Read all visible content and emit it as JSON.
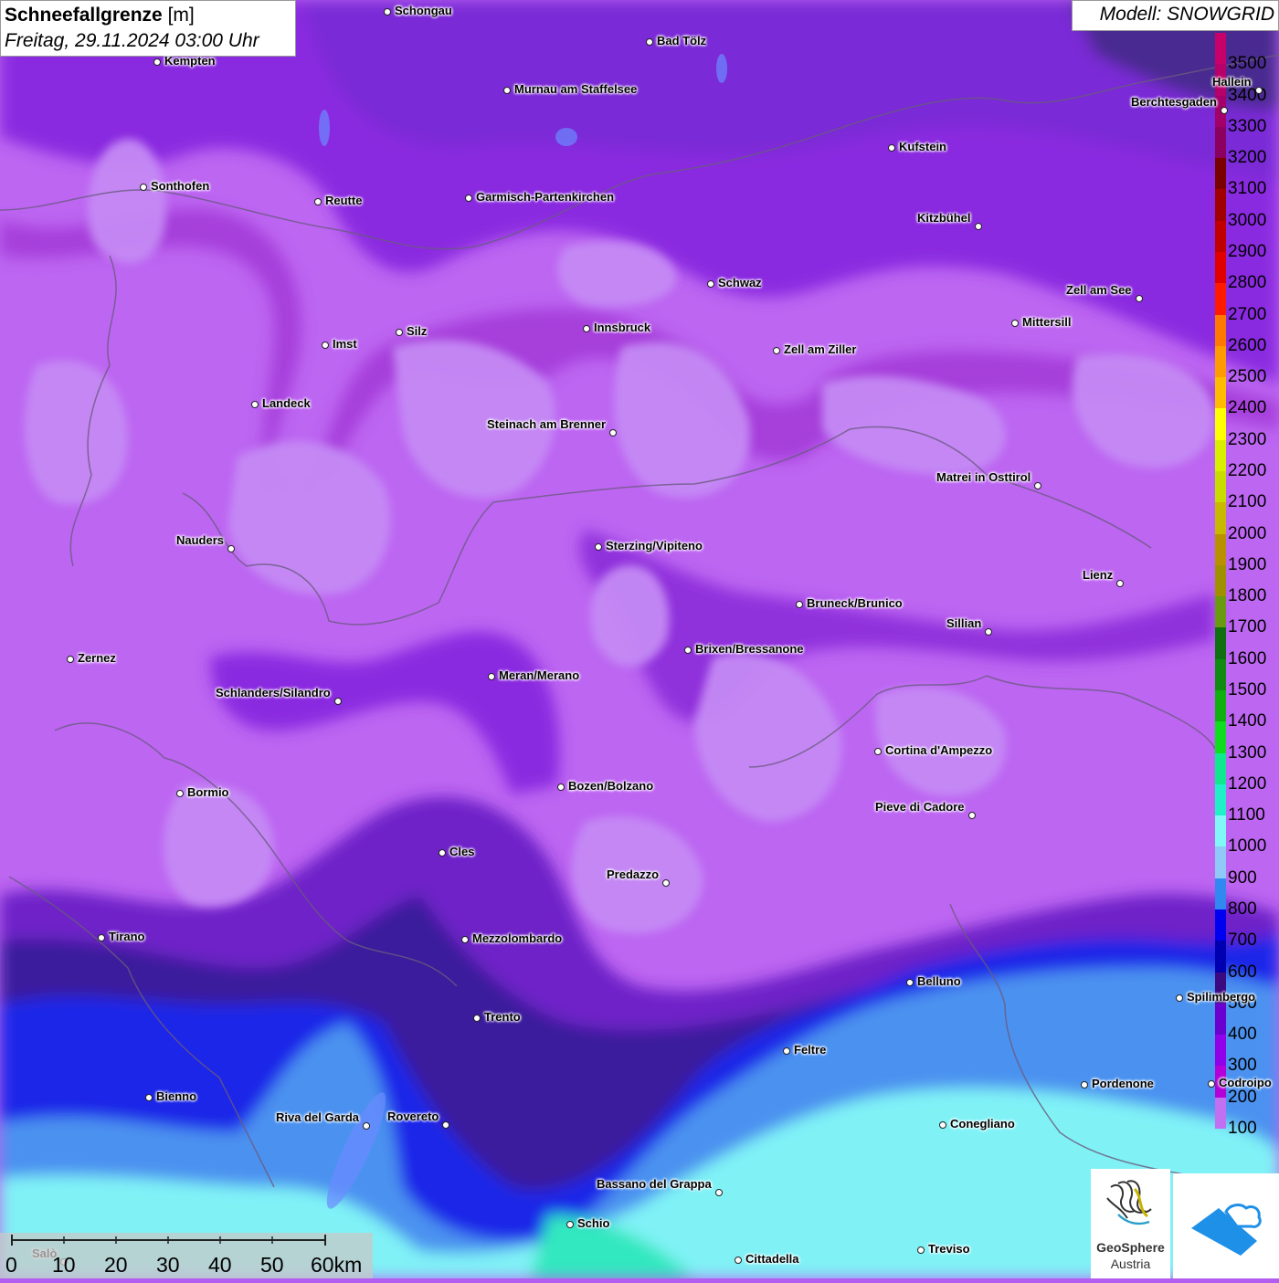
{
  "title": {
    "variable": "Schneefallgrenze",
    "unit": "[m]",
    "datetime": "Freitag, 29.11.2024 03:00 Uhr"
  },
  "model": "Modell: SNOWGRID",
  "legend": {
    "levels": [
      {
        "label": "3500",
        "color": "#c8006a"
      },
      {
        "label": "3400",
        "color": "#b8006a"
      },
      {
        "label": "3300",
        "color": "#a4006a"
      },
      {
        "label": "3200",
        "color": "#8c0060"
      },
      {
        "label": "3100",
        "color": "#7a0000"
      },
      {
        "label": "3000",
        "color": "#a00000"
      },
      {
        "label": "2900",
        "color": "#c00000"
      },
      {
        "label": "2800",
        "color": "#e00000"
      },
      {
        "label": "2700",
        "color": "#ff1a00"
      },
      {
        "label": "2600",
        "color": "#ff7800"
      },
      {
        "label": "2500",
        "color": "#ff9a00"
      },
      {
        "label": "2400",
        "color": "#ffbb00"
      },
      {
        "label": "2300",
        "color": "#ffff00"
      },
      {
        "label": "2200",
        "color": "#d8f000"
      },
      {
        "label": "2100",
        "color": "#c8dc00"
      },
      {
        "label": "2000",
        "color": "#c8b800"
      },
      {
        "label": "1900",
        "color": "#b89000"
      },
      {
        "label": "1800",
        "color": "#a09000"
      },
      {
        "label": "1700",
        "color": "#6a9a10"
      },
      {
        "label": "1600",
        "color": "#107010"
      },
      {
        "label": "1500",
        "color": "#108a10"
      },
      {
        "label": "1400",
        "color": "#10b010"
      },
      {
        "label": "1300",
        "color": "#10dc20"
      },
      {
        "label": "1200",
        "color": "#10e890"
      },
      {
        "label": "1100",
        "color": "#20f0c8"
      },
      {
        "label": "1000",
        "color": "#80f8f8"
      },
      {
        "label": "900",
        "color": "#90c8f8"
      },
      {
        "label": "800",
        "color": "#3088f0"
      },
      {
        "label": "700",
        "color": "#0000f0"
      },
      {
        "label": "600",
        "color": "#0000b0"
      },
      {
        "label": "500",
        "color": "#3c0a80"
      },
      {
        "label": "400",
        "color": "#6a00d0"
      },
      {
        "label": "300",
        "color": "#9000e8"
      },
      {
        "label": "200",
        "color": "#b400d8"
      },
      {
        "label": "100",
        "color": "#c070f0"
      }
    ]
  },
  "cities": [
    {
      "name": "Schongau"
    },
    {
      "name": "Bad Tölz"
    },
    {
      "name": "Kempten"
    },
    {
      "name": "Murnau am Staffelsee"
    },
    {
      "name": "Hallein"
    },
    {
      "name": "Berchtesgaden"
    },
    {
      "name": "Kufstein"
    },
    {
      "name": "Sonthofen"
    },
    {
      "name": "Reutte"
    },
    {
      "name": "Garmisch-Partenkirchen"
    },
    {
      "name": "Kitzbühel"
    },
    {
      "name": "Schwaz"
    },
    {
      "name": "Zell am See"
    },
    {
      "name": "Innsbruck"
    },
    {
      "name": "Mittersill"
    },
    {
      "name": "Imst"
    },
    {
      "name": "Silz"
    },
    {
      "name": "Zell am Ziller"
    },
    {
      "name": "Landeck"
    },
    {
      "name": "Steinach am Brenner"
    },
    {
      "name": "Matrei in Osttirol"
    },
    {
      "name": "Nauders"
    },
    {
      "name": "Sterzing/Vipiteno"
    },
    {
      "name": "Lienz"
    },
    {
      "name": "Bruneck/Brunico"
    },
    {
      "name": "Sillian"
    },
    {
      "name": "Zernez"
    },
    {
      "name": "Brixen/Bressanone"
    },
    {
      "name": "Meran/Merano"
    },
    {
      "name": "Schlanders/Silandro"
    },
    {
      "name": "Cortina d'Ampezzo"
    },
    {
      "name": "Bozen/Bolzano"
    },
    {
      "name": "Bormio"
    },
    {
      "name": "Pieve di Cadore"
    },
    {
      "name": "Cles"
    },
    {
      "name": "Predazzo"
    },
    {
      "name": "Tirano"
    },
    {
      "name": "Mezzolombardo"
    },
    {
      "name": "Belluno"
    },
    {
      "name": "Spilimbergo"
    },
    {
      "name": "Trento"
    },
    {
      "name": "Feltre"
    },
    {
      "name": "Pordenone"
    },
    {
      "name": "Codroipo"
    },
    {
      "name": "Bienno"
    },
    {
      "name": "Riva del Garda"
    },
    {
      "name": "Rovereto"
    },
    {
      "name": "Conegliano"
    },
    {
      "name": "Bassano del Grappa"
    },
    {
      "name": "Schio"
    },
    {
      "name": "Treviso"
    },
    {
      "name": "Cittadella"
    },
    {
      "name": "Salò"
    }
  ],
  "scale": {
    "ticks": [
      "0",
      "10",
      "20",
      "30",
      "40",
      "50",
      "60km"
    ]
  },
  "logos": {
    "geosphere_line1": "GeoSphere",
    "geosphere_line2": "Austria"
  }
}
